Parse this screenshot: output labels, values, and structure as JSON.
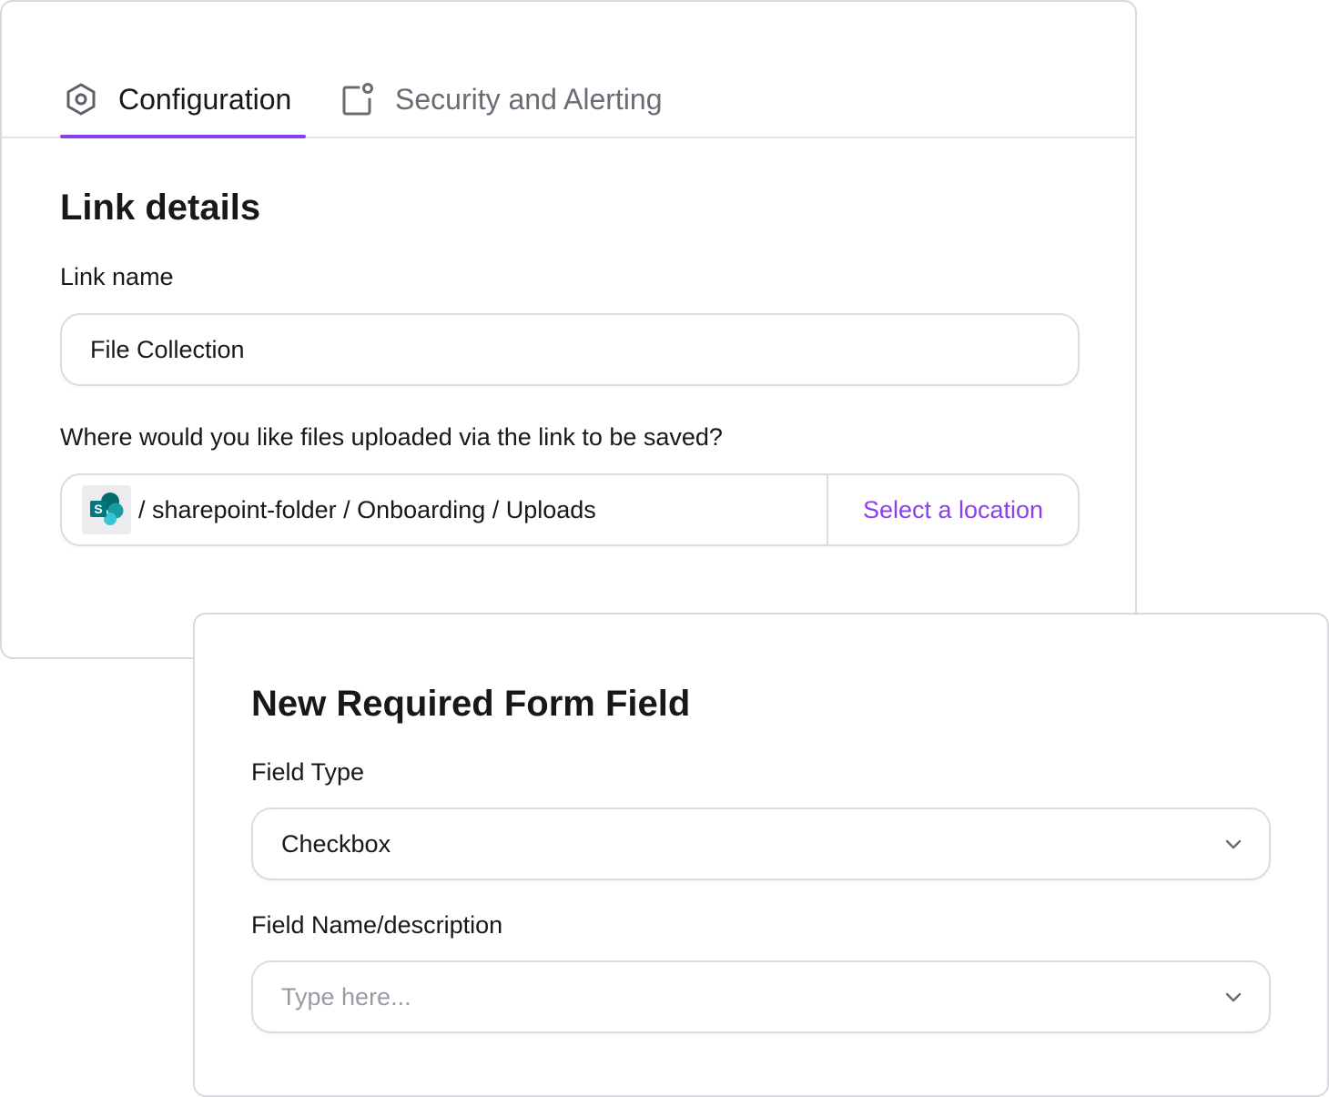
{
  "tabs": [
    {
      "label": "Configuration",
      "icon": "hexagon-settings-icon",
      "active": true
    },
    {
      "label": "Security and Alerting",
      "icon": "window-notification-icon",
      "active": false
    }
  ],
  "link_details": {
    "title": "Link details",
    "link_name_label": "Link name",
    "link_name_value": "File Collection",
    "location_question": "Where would you like files uploaded via the link to be saved?",
    "location_icon": "sharepoint-icon",
    "location_path": "/ sharepoint-folder / Onboarding / Uploads",
    "select_location_label": "Select a location"
  },
  "form_field": {
    "title": "New Required Form Field",
    "field_type_label": "Field Type",
    "field_type_value": "Checkbox",
    "field_name_label": "Field Name/description",
    "field_name_placeholder": "Type here..."
  },
  "colors": {
    "accent": "#8a3ff0",
    "border": "#dcdce0",
    "text": "#18181b",
    "muted": "#6b6b76",
    "sharepoint": "#038387"
  }
}
